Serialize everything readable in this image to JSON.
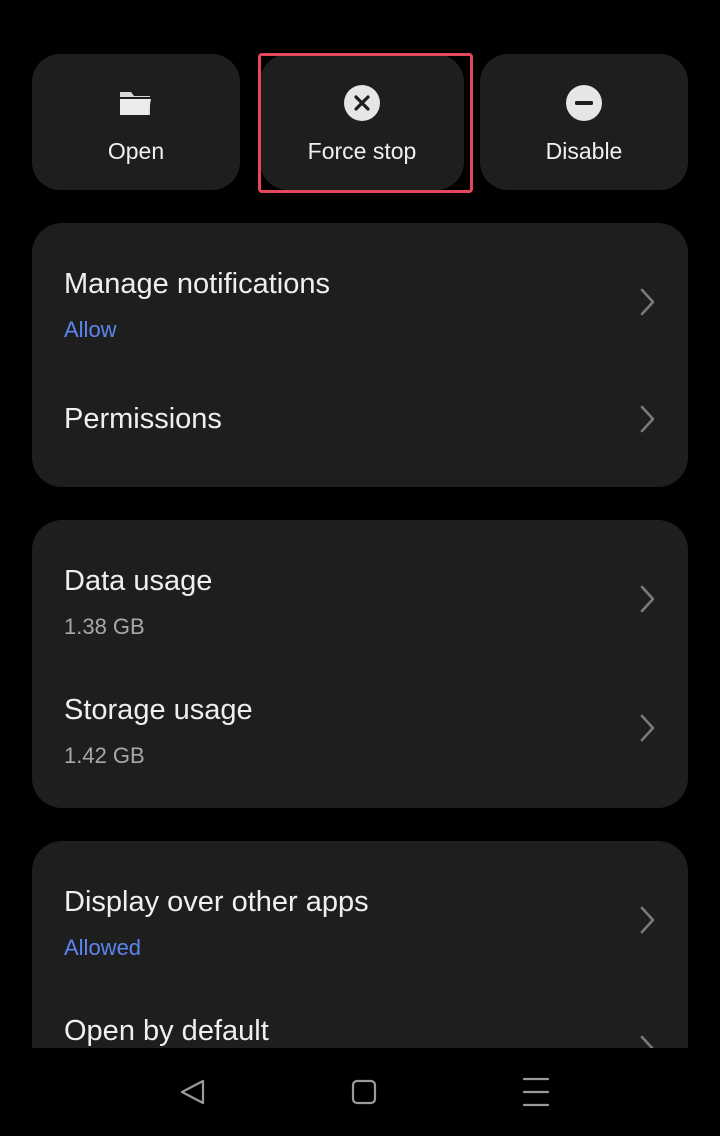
{
  "actions": {
    "open_label": "Open",
    "force_stop_label": "Force stop",
    "disable_label": "Disable",
    "open_icon": "folder-icon",
    "force_stop_icon": "close-circle-icon",
    "disable_icon": "minus-circle-icon"
  },
  "section1": {
    "items": [
      {
        "title": "Manage notifications",
        "subtitle": "Allow"
      },
      {
        "title": "Permissions"
      }
    ]
  },
  "section2": {
    "items": [
      {
        "title": "Data usage",
        "subtitle": "1.38 GB"
      },
      {
        "title": "Storage usage",
        "subtitle": "1.42 GB"
      }
    ]
  },
  "section3": {
    "items": [
      {
        "title": "Display over other apps",
        "subtitle": "Allowed"
      },
      {
        "title": "Open by default"
      }
    ]
  },
  "nav": {
    "back_icon": "back-triangle-icon",
    "home_icon": "home-square-icon",
    "recents_icon": "menu-lines-icon"
  },
  "colors": {
    "background": "#000000",
    "card": "#1e1e1e",
    "accent_blue": "#5b86f0",
    "highlight_red": "#e5485a"
  }
}
